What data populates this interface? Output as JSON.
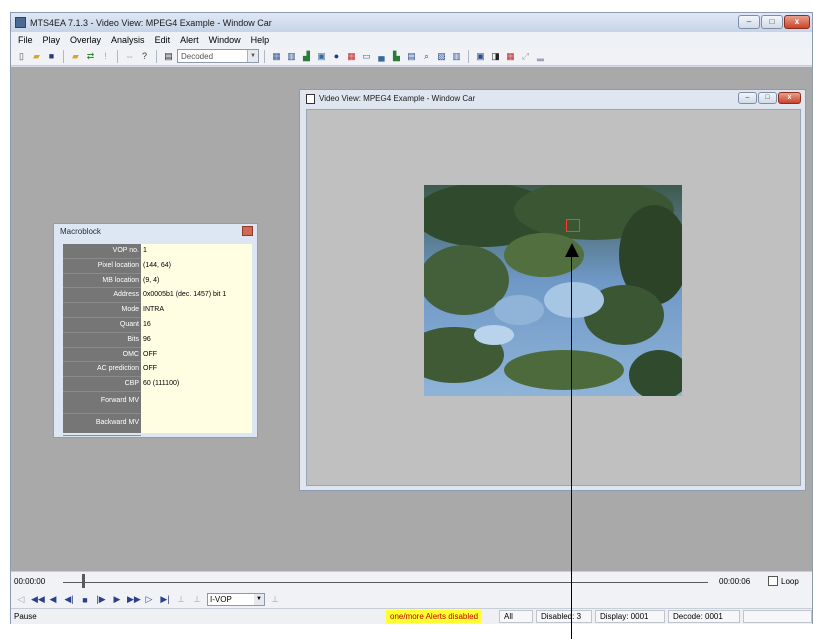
{
  "app": {
    "title": "MTS4EA 7.1.3 - Video View: MPEG4 Example - Window Car",
    "window_buttons": [
      "–",
      "□",
      "x"
    ]
  },
  "menu": [
    "File",
    "Play",
    "Overlay",
    "Analysis",
    "Edit",
    "Alert",
    "Window",
    "Help"
  ],
  "toolbar": {
    "decode_select": "Decoded"
  },
  "macroblock": {
    "title": "Macroblock",
    "rows": [
      {
        "label": "VOP no.",
        "value": "1"
      },
      {
        "label": "Pixel location",
        "value": "(144, 64)"
      },
      {
        "label": "MB location",
        "value": "(9, 4)"
      },
      {
        "label": "Address",
        "value": "0x0005b1 (dec. 1457) bit 1"
      },
      {
        "label": "Mode",
        "value": "INTRA"
      },
      {
        "label": "Quant",
        "value": "16"
      },
      {
        "label": "Bits",
        "value": "96"
      },
      {
        "label": "OMC",
        "value": "OFF"
      },
      {
        "label": "AC prediction",
        "value": "OFF"
      },
      {
        "label": "CBP",
        "value": "60 (111100)"
      },
      {
        "label": "Forward MV",
        "value": ""
      },
      {
        "label": "Backward MV",
        "value": ""
      }
    ]
  },
  "video_view": {
    "title": "Video View: MPEG4 Example - Window Car",
    "window_buttons": [
      "–",
      "□",
      "x"
    ]
  },
  "timeline": {
    "start": "00:00:00",
    "end": "00:00:06",
    "loop_label": "Loop",
    "position": 0.03
  },
  "controls": {
    "vop_select": "I-VOP"
  },
  "status": {
    "state": "Pause",
    "alert": "one/more Alerts disabled",
    "cells": [
      "All",
      "Disabled: 3",
      "Display: 0001",
      "Decode: 0001"
    ]
  },
  "colors": {
    "workspace": "#a9a9a9",
    "label_column": "#767676",
    "value_column": "#fffee3",
    "alert_bg": "#ffff33",
    "marker": "#ff3a30"
  }
}
